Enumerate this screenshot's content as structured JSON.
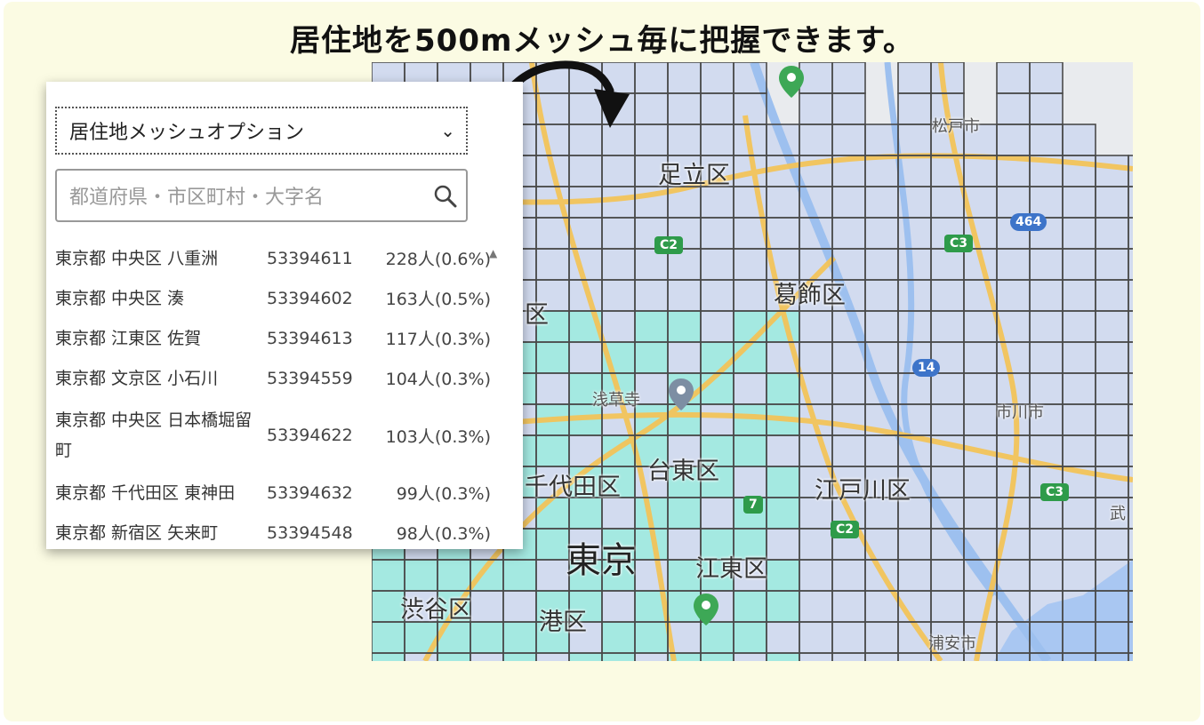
{
  "headline": "居住地を500mメッシュ毎に把握できます。",
  "panel": {
    "select_value": "居住地メッシュオプション",
    "search_placeholder": "都道府県・市区町村・大字名",
    "rows": [
      {
        "name": "東京都 中央区 八重洲",
        "code": "53394611",
        "count": "228人(0.6%)"
      },
      {
        "name": "東京都 中央区 湊",
        "code": "53394602",
        "count": "163人(0.5%)"
      },
      {
        "name": "東京都 江東区 佐賀",
        "code": "53394613",
        "count": "117人(0.3%)"
      },
      {
        "name": "東京都 文京区 小石川",
        "code": "53394559",
        "count": "104人(0.3%)"
      },
      {
        "name": "東京都 中央区 日本橋堀留町",
        "code": "53394622",
        "count": "103人(0.3%)"
      },
      {
        "name": "東京都 千代田区 東神田",
        "code": "53394632",
        "count": "99人(0.3%)"
      },
      {
        "name": "東京都 新宿区 矢来町",
        "code": "53394548",
        "count": "98人(0.3%)"
      }
    ]
  },
  "map": {
    "labels": {
      "adachi": "足立区",
      "matsudo": "松戸市",
      "katsushika": "葛飾区",
      "ku_partial": "区",
      "asakusa": "浅草寺",
      "taito": "台東区",
      "ichikawa": "市川市",
      "edogawa": "江戸川区",
      "chiyoda": "千代田区",
      "tokyo": "東京",
      "koto": "江東区",
      "shibuya": "渋谷区",
      "minato": "港区",
      "urayasu": "浦安市",
      "bu": "武"
    },
    "shields": {
      "c2_top": "C2",
      "c2_bottom": "C2",
      "c3_top": "C3",
      "c3_right": "C3",
      "r464": "464",
      "r14": "14",
      "r7": "7"
    }
  },
  "colors": {
    "mesh_blue": "#c9d5ef",
    "mesh_teal": "#8ce8dc",
    "grid_line": "#4a4a4a",
    "road": "#f3c45a",
    "background": "#fbfbe3"
  }
}
